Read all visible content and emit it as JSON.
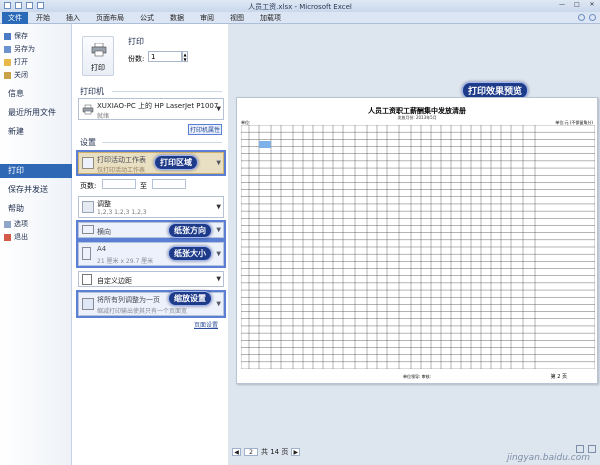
{
  "window": {
    "title": "人员工资.xlsx - Microsoft Excel",
    "controls": [
      "—",
      "□",
      "✕"
    ]
  },
  "ribbon": {
    "file_tab": "文件",
    "tabs": [
      "开始",
      "插入",
      "页面布局",
      "公式",
      "数据",
      "审阅",
      "视图",
      "加载项"
    ]
  },
  "nav": {
    "small_items": [
      "保存",
      "另存为",
      "打开",
      "关闭"
    ],
    "big_items": [
      "信息",
      "最近所用文件",
      "新建"
    ],
    "selected": "打印",
    "items_after": [
      "保存并发送",
      "帮助"
    ],
    "small_items_bottom": [
      "选项",
      "退出"
    ]
  },
  "print": {
    "heading": "打印",
    "button_label": "打印",
    "copies_label": "份数:",
    "copies_value": "1"
  },
  "printer": {
    "section_title": "打印机",
    "name": "XUXIAO-PC 上的 HP LaserJet P1007",
    "status": "就绪",
    "properties_link": "打印机属性"
  },
  "settings": {
    "section_title": "设置",
    "area_main": "打印活动工作表",
    "area_sub": "仅打印活动工作表",
    "pages_label": "页数:",
    "to_label": "至",
    "collate_main": "调整",
    "collate_sub": "1,2,3  1,2,3  1,2,3",
    "orientation": "横向",
    "paper_main": "A4",
    "paper_sub": "21 厘米 x 29.7 厘米",
    "margins": "自定义边距",
    "scale_main": "将所有列调整为一页",
    "scale_sub": "缩减打印输出使其只有一个页面宽",
    "page_setup_link": "页面设置"
  },
  "callouts": {
    "preview": "打印效果预览",
    "area": "打印区域",
    "orientation": "纸张方向",
    "paper": "纸张大小",
    "scale": "缩放设置"
  },
  "preview": {
    "doc_title": "人员工资职工薪酬集中发放清册",
    "doc_sub": "发放月份: 2013年5月",
    "doc_left": "单位:",
    "doc_right": "单位:元 (不保留角分)",
    "doc_footer": "单位领导:    审核:",
    "doc_page": "第 2 页",
    "page_current": "2",
    "page_total_label": "共 14 页",
    "prev_arrow": "◀",
    "next_arrow": "▶"
  },
  "watermark": "jingyan.baidu.com",
  "colors": {
    "accent": "#2f68b5",
    "callout": "#1e3b8a",
    "highlight": "#5a7fd4"
  }
}
